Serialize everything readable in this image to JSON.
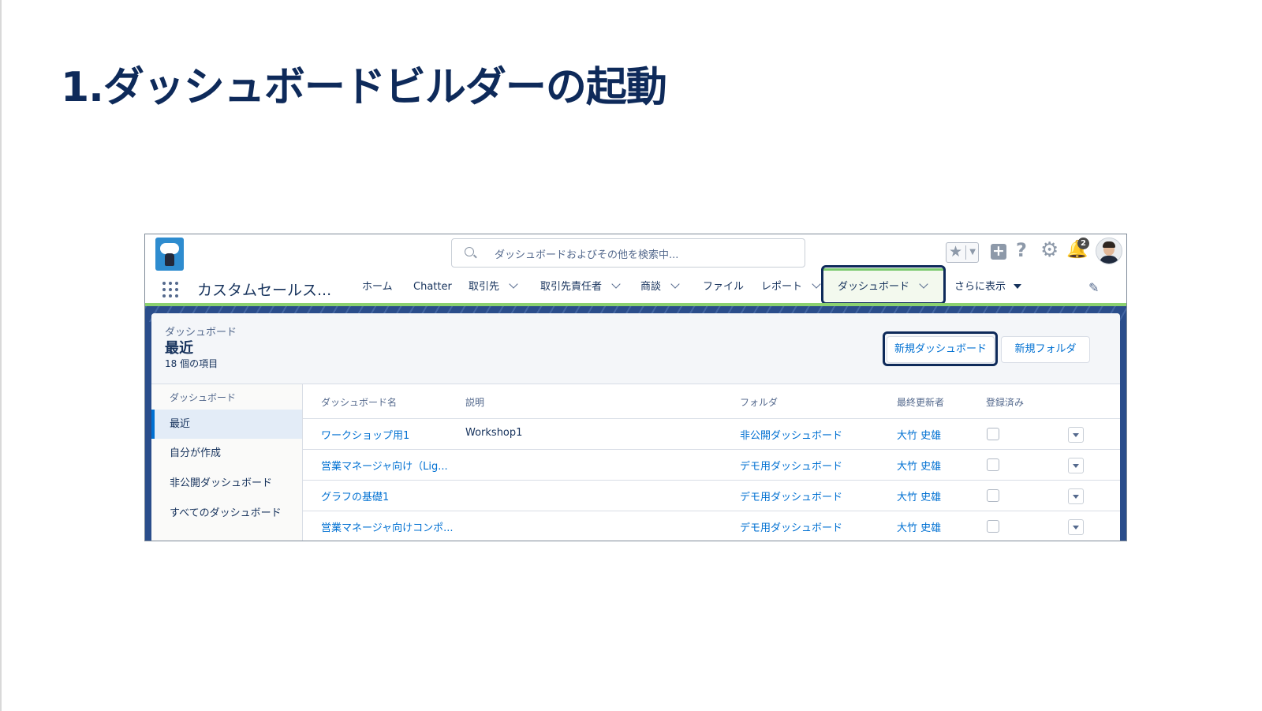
{
  "slide": {
    "title": "1.ダッシュボードビルダーの起動"
  },
  "header": {
    "search_placeholder": "ダッシュボードおよびその他を検索中...",
    "notification_count": "2",
    "app_name": "カスタムセールス..."
  },
  "nav": {
    "items": [
      {
        "label": "ホーム",
        "has_menu": false
      },
      {
        "label": "Chatter",
        "has_menu": false
      },
      {
        "label": "取引先",
        "has_menu": true
      },
      {
        "label": "取引先責任者",
        "has_menu": true
      },
      {
        "label": "商談",
        "has_menu": true
      },
      {
        "label": "ファイル",
        "has_menu": false
      },
      {
        "label": "レポート",
        "has_menu": true
      },
      {
        "label": "ダッシュボード",
        "has_menu": true,
        "active": true
      }
    ],
    "more_label": "さらに表示"
  },
  "page_header": {
    "object_label": "ダッシュボード",
    "list_title": "最近",
    "item_count": "18 個の項目",
    "new_dashboard_button": "新規ダッシュボード",
    "new_folder_button": "新規フォルダ"
  },
  "sidebar": {
    "heading": "ダッシュボード",
    "items": [
      {
        "label": "最近",
        "active": true
      },
      {
        "label": "自分が作成"
      },
      {
        "label": "非公開ダッシュボード"
      },
      {
        "label": "すべてのダッシュボード"
      }
    ]
  },
  "table": {
    "columns": [
      "ダッシュボード名",
      "説明",
      "フォルダ",
      "最終更新者",
      "登録済み"
    ],
    "rows": [
      {
        "name": "ワークショップ用1",
        "description": "Workshop1",
        "folder": "非公開ダッシュボード",
        "modified_by": "大竹 史雄",
        "subscribed": false
      },
      {
        "name": "営業マネージャ向け（Lig...",
        "description": "",
        "folder": "デモ用ダッシュボード",
        "modified_by": "大竹 史雄",
        "subscribed": false
      },
      {
        "name": "グラフの基礎1",
        "description": "",
        "folder": "デモ用ダッシュボード",
        "modified_by": "大竹 史雄",
        "subscribed": false
      },
      {
        "name": "営業マネージャ向けコンポ...",
        "description": "",
        "folder": "デモ用ダッシュボード",
        "modified_by": "大竹 史雄",
        "subscribed": false
      }
    ]
  },
  "colors": {
    "title": "#0e2a5a",
    "link": "#0070d2",
    "highlight_box": "#0e2a5a",
    "nav_active_bar": "#7bc96f",
    "band": "#2a4d8b"
  }
}
